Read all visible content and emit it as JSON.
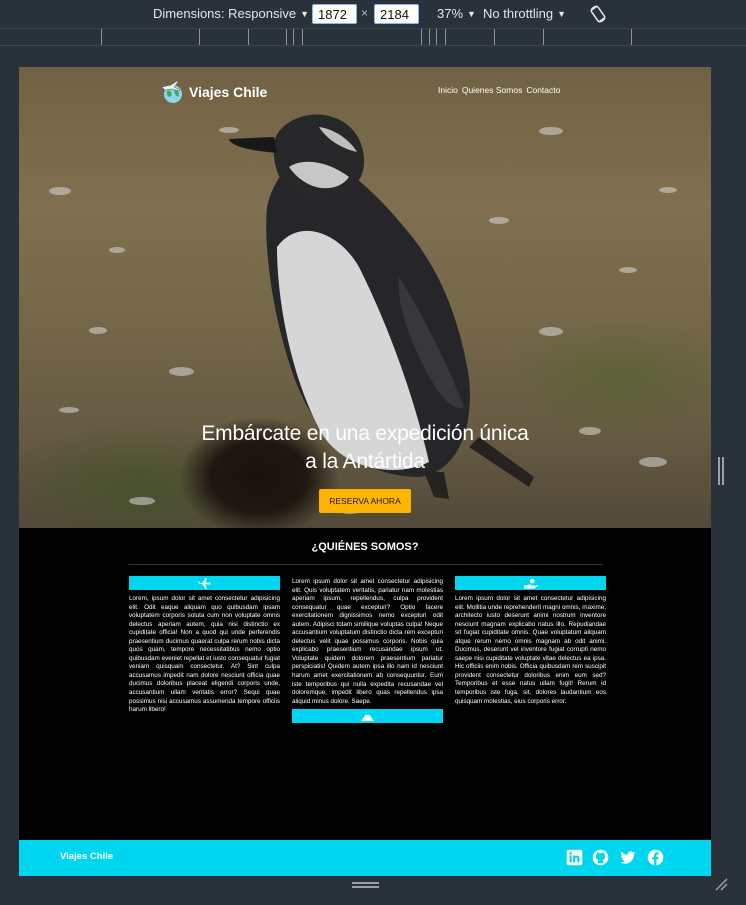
{
  "toolbar": {
    "dimensions_label": "Dimensions: Responsive",
    "width_value": "1872",
    "times": "×",
    "height_value": "2184",
    "zoom": "37%",
    "throttling": "No throttling"
  },
  "site": {
    "brand": "Viajes Chile",
    "nav": [
      "Inicio",
      "Quienes Somos",
      "Contacto"
    ],
    "hero_title_line1": "Embárcate en una expedición única",
    "hero_title_line2": "a la Antártida",
    "hero_button": "RESERVA AHORA",
    "section_title": "¿QUIÉNES SOMOS?",
    "col1_text": "Lorem, ipsum dolor sit amet consectetur adipisicing elit. Odit eaque aliquam quo quibusdam ipsam voluptatem corporis soluta cum non voluptate omnis delectus aperiam autem, quia nisi distinctio ex cupiditate officia! Non a quod qui unde perferendis praesentium ducimus quaerat culpa rerum nobis dicta quos quam, tempore necessitatibus nemo optio quibusdam eveniet repellat et iusto consequatur fugiat veniam quisquam consectetur. At? Sint culpa accusamus impedit nam dolore nesciunt officia quae ducimus doloribus placeat eligendi corporis unde, accusantium ullam veritatis error? Sequi quae possimus nisi accusamus assumenda tempore officiis harum libero!",
    "col2_text": "Lorem ipsum dolor sit amet consectetur adipisicing elit. Quis voluptatem veritatis, pariatur nam molestias aperiam ipsum, repellendus, culpa provident consequatur quae excepturi? Optio facere exercitationem dignissimos nemo excepturi odit autem. Adipisci totam similique voluptas culpa! Neque accusantium voluptatum distinctio dicta rem excepturi delectus velit quae possimus corporis. Nobis quia explicabo praesentium recusandae ipsum ut. Voluptate quidem dolorem praesentium pariatur perspiciatis! Quidem autem ipsa illo nam id nesciunt harum amet exercitationem ab consequuntur. Eum iste temporibus qui nulla expedita recusandae vel doloremque, impedit libero quas repellendus ipsa aliquid minus dolore. Saepe.",
    "col3_text": "Lorem ipsum dolor sit amet consectetur adipisicing elit. Mollitia unde reprehenderit magni omnis, maxime, architecto iusto deserunt animi nostrum inventore nesciunt magnam explicabo natus illo. Repudiandae sit fugiat cupiditate omnis. Quae voluptatum aliquam atque rerum nemo omnis magnam ab odit animi. Ducimus, deserunt vel inventore fugiat corrupti nemo saepe nisi cupiditate voluptate vitae delectus ea ipsa. Hic officiis enim nobis. Officia quibusdam rem suscipit provident consectetur doloribus enim eum sed? Temporibus et esse natus ullam fugit! Rerum id temporibus iste fuga, sit, dolores laudantium eos quisquam molestias, eius corporis error.",
    "footer_brand": "Viajes Chile",
    "social_icons": [
      "linkedin-icon",
      "github-icon",
      "twitter-icon",
      "facebook-icon"
    ],
    "colors": {
      "accent": "#00d6f0",
      "button": "#ffb400",
      "background": "#000000"
    }
  }
}
